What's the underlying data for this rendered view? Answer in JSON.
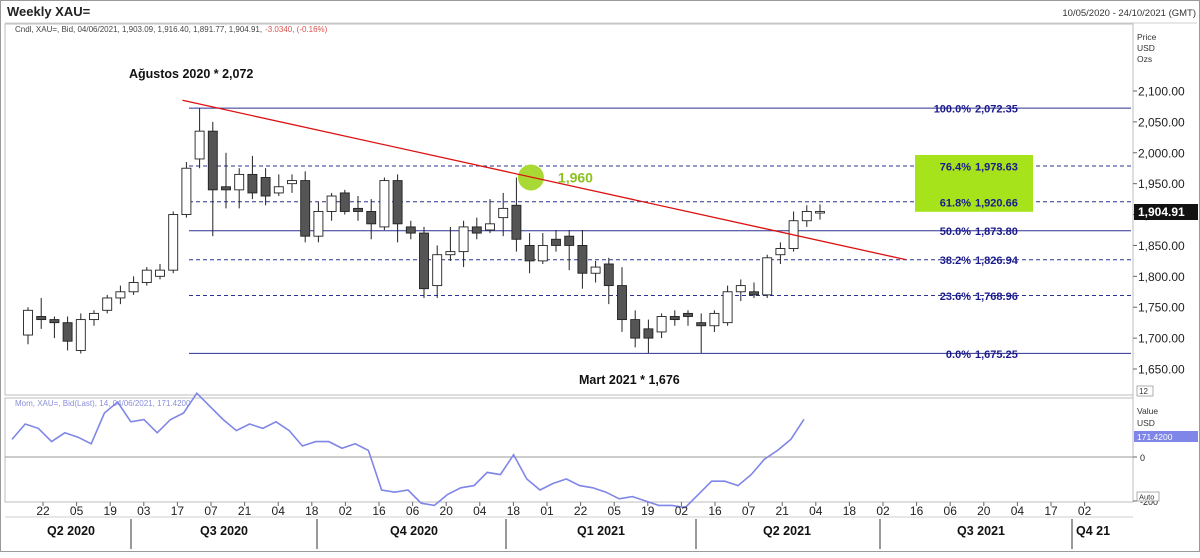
{
  "header": {
    "title": "Weekly XAU=",
    "date_range": "10/05/2020 - 24/10/2021 (GMT)",
    "legend": "Cndl, XAU=, Bid, 04/06/2021, 1,903.09, 1,916.40, 1,891.77, 1,904.91,",
    "legend_change": "-3.0340, (-0.16%)"
  },
  "price_axis": {
    "title_lines": [
      "Price",
      "USD",
      "Ozs"
    ],
    "ticks": [
      "2,100.00",
      "2,050.00",
      "2,000.00",
      "1,950.00",
      "1,900.00",
      "1,850.00",
      "1,800.00",
      "1,750.00",
      "1,700.00",
      "1,650.00"
    ],
    "current_price": "1,904.91",
    "scale_badge": "12"
  },
  "momentum_axis": {
    "title_lines": [
      "Value",
      "USD"
    ],
    "value_badge": "171.4200",
    "ticks": [
      "0",
      "-200"
    ],
    "auto_label": "Auto"
  },
  "momentum_legend": "Mom, XAU=, Bid(Last), 14, 04/06/2021, 171.4200",
  "annotations": {
    "high": "Ağustos 2020 * 2,072",
    "low": "Mart 2021 * 1,676",
    "touch": "1,960"
  },
  "colors": {
    "candle_up": "#ffffff",
    "candle_down": "#555555",
    "trendline": "#dd1111",
    "fib_line": "#2e3192",
    "fib_text": "#1a1a8c",
    "momentum": "#7f86e8",
    "highlight_box": "#a6e31b",
    "touch_circle": "#a8d934",
    "touch_text": "#8cc21d",
    "change_text": "#d9534f"
  },
  "x_axis": {
    "week_labels": [
      "22",
      "05",
      "19",
      "03",
      "17",
      "07",
      "21",
      "04",
      "18",
      "02",
      "16",
      "06",
      "20",
      "04",
      "18",
      "01",
      "22",
      "05",
      "19",
      "02",
      "16",
      "07",
      "21",
      "04",
      "18",
      "02",
      "16",
      "06",
      "20",
      "04",
      "17",
      "02"
    ],
    "quarter_labels": [
      "Q2 2020",
      "Q3 2020",
      "Q4 2020",
      "Q1 2021",
      "Q2 2021",
      "Q3 2021",
      "Q4 21"
    ]
  },
  "chart_data": {
    "type": "candlestick",
    "title": "Weekly XAU=",
    "ylabel": "Price USD Ozs",
    "ylim": [
      1635,
      2120
    ],
    "candles": [
      {
        "o": 1705,
        "h": 1750,
        "l": 1690,
        "c": 1745
      },
      {
        "o": 1735,
        "h": 1765,
        "l": 1715,
        "c": 1730
      },
      {
        "o": 1730,
        "h": 1735,
        "l": 1700,
        "c": 1725
      },
      {
        "o": 1725,
        "h": 1735,
        "l": 1680,
        "c": 1695
      },
      {
        "o": 1680,
        "h": 1740,
        "l": 1675,
        "c": 1730
      },
      {
        "o": 1730,
        "h": 1745,
        "l": 1720,
        "c": 1740
      },
      {
        "o": 1745,
        "h": 1770,
        "l": 1740,
        "c": 1765
      },
      {
        "o": 1765,
        "h": 1785,
        "l": 1755,
        "c": 1775
      },
      {
        "o": 1775,
        "h": 1800,
        "l": 1770,
        "c": 1790
      },
      {
        "o": 1790,
        "h": 1815,
        "l": 1785,
        "c": 1810
      },
      {
        "o": 1800,
        "h": 1820,
        "l": 1795,
        "c": 1810
      },
      {
        "o": 1810,
        "h": 1905,
        "l": 1805,
        "c": 1900
      },
      {
        "o": 1900,
        "h": 1985,
        "l": 1895,
        "c": 1975
      },
      {
        "o": 1990,
        "h": 2072,
        "l": 1975,
        "c": 2035
      },
      {
        "o": 2035,
        "h": 2050,
        "l": 1865,
        "c": 1940
      },
      {
        "o": 1945,
        "h": 2000,
        "l": 1910,
        "c": 1940
      },
      {
        "o": 1940,
        "h": 1975,
        "l": 1910,
        "c": 1965
      },
      {
        "o": 1965,
        "h": 1995,
        "l": 1925,
        "c": 1935
      },
      {
        "o": 1960,
        "h": 1975,
        "l": 1915,
        "c": 1930
      },
      {
        "o": 1935,
        "h": 1965,
        "l": 1930,
        "c": 1945
      },
      {
        "o": 1950,
        "h": 1965,
        "l": 1935,
        "c": 1955
      },
      {
        "o": 1955,
        "h": 1970,
        "l": 1855,
        "c": 1865
      },
      {
        "o": 1865,
        "h": 1920,
        "l": 1855,
        "c": 1905
      },
      {
        "o": 1905,
        "h": 1935,
        "l": 1890,
        "c": 1930
      },
      {
        "o": 1935,
        "h": 1940,
        "l": 1900,
        "c": 1905
      },
      {
        "o": 1910,
        "h": 1930,
        "l": 1890,
        "c": 1905
      },
      {
        "o": 1905,
        "h": 1925,
        "l": 1860,
        "c": 1885
      },
      {
        "o": 1880,
        "h": 1960,
        "l": 1875,
        "c": 1955
      },
      {
        "o": 1955,
        "h": 1965,
        "l": 1855,
        "c": 1885
      },
      {
        "o": 1880,
        "h": 1890,
        "l": 1860,
        "c": 1870
      },
      {
        "o": 1870,
        "h": 1880,
        "l": 1765,
        "c": 1780
      },
      {
        "o": 1785,
        "h": 1850,
        "l": 1765,
        "c": 1835
      },
      {
        "o": 1835,
        "h": 1880,
        "l": 1825,
        "c": 1840
      },
      {
        "o": 1840,
        "h": 1890,
        "l": 1815,
        "c": 1880
      },
      {
        "o": 1880,
        "h": 1895,
        "l": 1860,
        "c": 1870
      },
      {
        "o": 1875,
        "h": 1925,
        "l": 1870,
        "c": 1885
      },
      {
        "o": 1895,
        "h": 1935,
        "l": 1865,
        "c": 1910
      },
      {
        "o": 1915,
        "h": 1960,
        "l": 1840,
        "c": 1860
      },
      {
        "o": 1850,
        "h": 1870,
        "l": 1805,
        "c": 1825
      },
      {
        "o": 1825,
        "h": 1870,
        "l": 1820,
        "c": 1850
      },
      {
        "o": 1860,
        "h": 1875,
        "l": 1840,
        "c": 1850
      },
      {
        "o": 1865,
        "h": 1875,
        "l": 1810,
        "c": 1850
      },
      {
        "o": 1850,
        "h": 1875,
        "l": 1780,
        "c": 1805
      },
      {
        "o": 1805,
        "h": 1825,
        "l": 1790,
        "c": 1815
      },
      {
        "o": 1820,
        "h": 1830,
        "l": 1755,
        "c": 1785
      },
      {
        "o": 1785,
        "h": 1815,
        "l": 1710,
        "c": 1730
      },
      {
        "o": 1730,
        "h": 1745,
        "l": 1685,
        "c": 1700
      },
      {
        "o": 1715,
        "h": 1730,
        "l": 1676,
        "c": 1700
      },
      {
        "o": 1710,
        "h": 1740,
        "l": 1700,
        "c": 1735
      },
      {
        "o": 1735,
        "h": 1745,
        "l": 1720,
        "c": 1730
      },
      {
        "o": 1740,
        "h": 1745,
        "l": 1720,
        "c": 1735
      },
      {
        "o": 1725,
        "h": 1740,
        "l": 1676,
        "c": 1720
      },
      {
        "o": 1720,
        "h": 1745,
        "l": 1710,
        "c": 1740
      },
      {
        "o": 1725,
        "h": 1785,
        "l": 1720,
        "c": 1775
      },
      {
        "o": 1775,
        "h": 1795,
        "l": 1760,
        "c": 1785
      },
      {
        "o": 1775,
        "h": 1790,
        "l": 1765,
        "c": 1770
      },
      {
        "o": 1770,
        "h": 1835,
        "l": 1765,
        "c": 1830
      },
      {
        "o": 1835,
        "h": 1855,
        "l": 1820,
        "c": 1845
      },
      {
        "o": 1845,
        "h": 1905,
        "l": 1840,
        "c": 1890
      },
      {
        "o": 1890,
        "h": 1915,
        "l": 1880,
        "c": 1905
      },
      {
        "o": 1903.09,
        "h": 1916.4,
        "l": 1891.77,
        "c": 1904.91
      }
    ],
    "trendline": {
      "from": {
        "i": 11.7,
        "price": 2085
      },
      "to": {
        "i": 66.5,
        "price": 1827
      }
    },
    "touch_point": {
      "i": 38.1,
      "price": 1960
    },
    "fibonacci": {
      "x_from_index": 13,
      "levels": [
        {
          "pct": "100.0%",
          "value": "2,072.35",
          "price": 2072.35,
          "style": "solid"
        },
        {
          "pct": "76.4%",
          "value": "1,978.63",
          "price": 1978.63,
          "style": "dashed"
        },
        {
          "pct": "61.8%",
          "value": "1,920.66",
          "price": 1920.66,
          "style": "dashed"
        },
        {
          "pct": "50.0%",
          "value": "1,873.80",
          "price": 1873.8,
          "style": "solid"
        },
        {
          "pct": "38.2%",
          "value": "1,826.94",
          "price": 1826.94,
          "style": "dashed"
        },
        {
          "pct": "23.6%",
          "value": "1,768.96",
          "price": 1768.96,
          "style": "dashed"
        },
        {
          "pct": "0.0%",
          "value": "1,675.25",
          "price": 1675.25,
          "style": "solid"
        }
      ]
    },
    "momentum": {
      "ylim": [
        -380,
        360
      ],
      "values": [
        80,
        150,
        130,
        70,
        110,
        90,
        60,
        200,
        250,
        160,
        170,
        110,
        170,
        200,
        290,
        230,
        170,
        120,
        150,
        130,
        160,
        120,
        50,
        70,
        70,
        40,
        60,
        30,
        -150,
        -160,
        -150,
        -210,
        -220,
        -170,
        -140,
        -130,
        -70,
        -80,
        10,
        -100,
        -150,
        -120,
        -100,
        -130,
        -140,
        -160,
        -190,
        -180,
        -200,
        -220,
        -220,
        -230,
        -170,
        -110,
        -110,
        -130,
        -80,
        -10,
        30,
        80,
        171.42
      ]
    }
  }
}
